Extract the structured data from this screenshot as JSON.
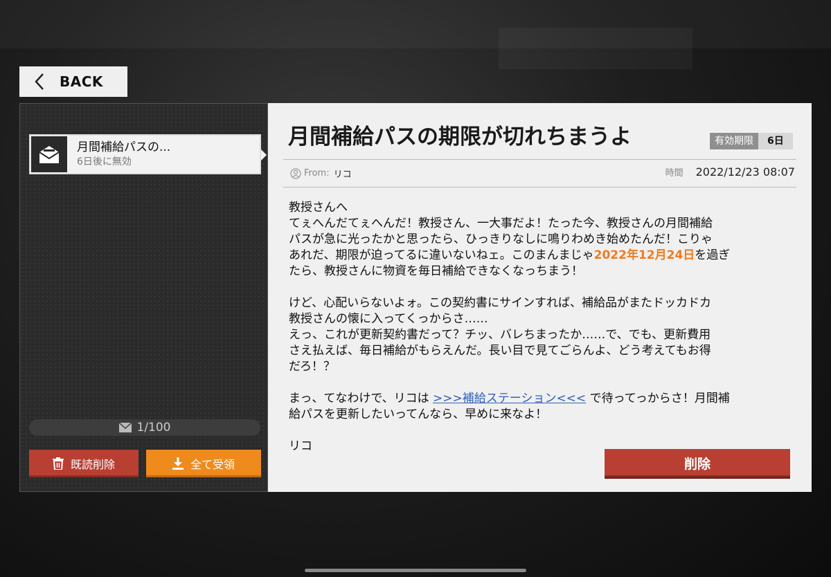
{
  "nav": {
    "back_label": "BACK"
  },
  "mail_list": {
    "items": [
      {
        "title": "月間補給パスの...",
        "status": "6日後に無効"
      }
    ],
    "count": "1/100",
    "delete_read_label": "既読削除",
    "receive_all_label": "全て受領"
  },
  "mail": {
    "subject": "月間補給パスの期限が切れちまうよ",
    "expiry_label": "有効期限",
    "expiry_value": "6日",
    "from_label": "From:",
    "from_name": "リコ",
    "time_label": "時間",
    "time_value": "2022/12/23 08:07",
    "body": {
      "l1": "教授さんへ",
      "l2": "てぇへんだてぇへんだ！教授さん、一大事だよ！たった今、教授さんの月間補給",
      "l3": "パスが急に光ったかと思ったら、ひっきりなしに鳴りわめき始めたんだ！こりゃ",
      "l4a": "あれだ、期限が迫ってるに違いないねェ。このまんまじゃ",
      "l4_date": "2022年12月24日",
      "l4b": "を過ぎ",
      "l5": "たら、教授さんに物資を毎日補給できなくなっちまう！",
      "l6": "けど、心配いらないよォ。この契約書にサインすれば、補給品がまたドッカドカ",
      "l7": "教授さんの懐に入ってくっからさ……",
      "l8": "えっ、これが更新契約書だって？チッ、バレちまったか……で、でも、更新費用",
      "l9": "さえ払えば、毎日補給がもらえんだ。長い目で見てごらんよ、どう考えてもお得",
      "l10": "だろ！？",
      "l11a": " まっ、てなわけで、リコは ",
      "l11_link": ">>>補給ステーション<<<",
      "l11b": " で待ってっからさ！月間補",
      "l12": "給パスを更新したいってんなら、早めに来なよ！",
      "sign": "リコ"
    },
    "delete_label": "削除"
  },
  "colors": {
    "accent_red": "#b93f33",
    "accent_orange": "#ef8a1d",
    "highlight": "#ef7a1d",
    "link": "#2f5fb8"
  }
}
